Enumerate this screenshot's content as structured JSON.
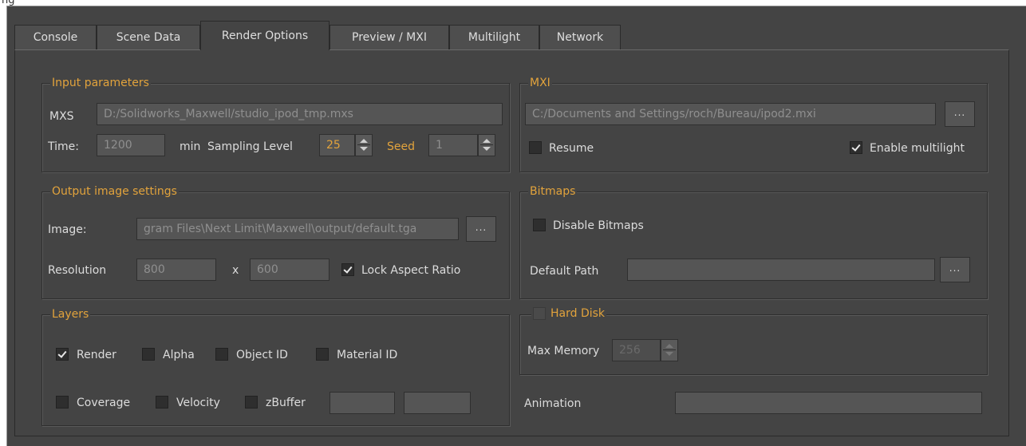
{
  "window": {
    "title_fragment": "ng"
  },
  "tabs": [
    {
      "label": "Console",
      "active": false
    },
    {
      "label": "Scene Data",
      "active": false
    },
    {
      "label": "Render Options",
      "active": true
    },
    {
      "label": "Preview / MXI",
      "active": false
    },
    {
      "label": "Multilight",
      "active": false
    },
    {
      "label": "Network",
      "active": false
    }
  ],
  "input_parameters": {
    "title": "Input parameters",
    "mxs_label": "MXS",
    "mxs_value": "D:/Solidworks_Maxwell/studio_ipod_tmp.mxs",
    "time_label": "Time:",
    "time_value": "1200",
    "time_unit": "min",
    "sampling_label": "Sampling Level",
    "sampling_value": "25",
    "seed_label": "Seed",
    "seed_value": "1"
  },
  "mxi": {
    "title": "MXI",
    "path_value": "C:/Documents and Settings/roch/Bureau/ipod2.mxi",
    "browse_label": "...",
    "resume_label": "Resume",
    "resume_checked": false,
    "multilight_label": "Enable multilight",
    "multilight_checked": true
  },
  "output_image": {
    "title": "Output image settings",
    "image_label": "Image:",
    "image_value": "gram Files\\Next Limit\\Maxwell\\output/default.tga",
    "browse_label": "...",
    "resolution_label": "Resolution",
    "width_value": "800",
    "x_label": "x",
    "height_value": "600",
    "lock_label": "Lock Aspect Ratio",
    "lock_checked": true
  },
  "bitmaps": {
    "title": "Bitmaps",
    "disable_label": "Disable Bitmaps",
    "disable_checked": false,
    "default_path_label": "Default Path",
    "default_path_value": "",
    "browse_label": "..."
  },
  "layers": {
    "title": "Layers",
    "render_label": "Render",
    "render_checked": true,
    "alpha_label": "Alpha",
    "object_id_label": "Object ID",
    "material_id_label": "Material ID",
    "coverage_label": "Coverage",
    "velocity_label": "Velocity",
    "zbuffer_label": "zBuffer",
    "zbuffer_min": "",
    "zbuffer_max": ""
  },
  "hard_disk": {
    "title": "Hard Disk",
    "checked": false,
    "max_memory_label": "Max Memory",
    "max_memory_value": "256"
  },
  "animation": {
    "label": "Animation",
    "value": ""
  },
  "colors": {
    "background": "#444444",
    "accent": "#e2a33c",
    "field": "#555555"
  }
}
